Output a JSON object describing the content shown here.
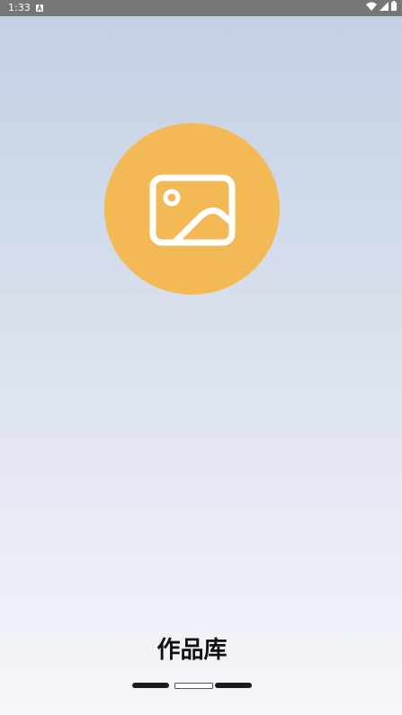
{
  "status_bar": {
    "time": "1:33",
    "app_icon": "a-icon",
    "right_icons": [
      "wifi-icon",
      "signal-icon",
      "battery-icon"
    ]
  },
  "hero": {
    "icon": "image-icon",
    "circle_color": "#f3b954"
  },
  "page_title": "作品库",
  "pager": {
    "total": 3,
    "active_index": 1
  }
}
